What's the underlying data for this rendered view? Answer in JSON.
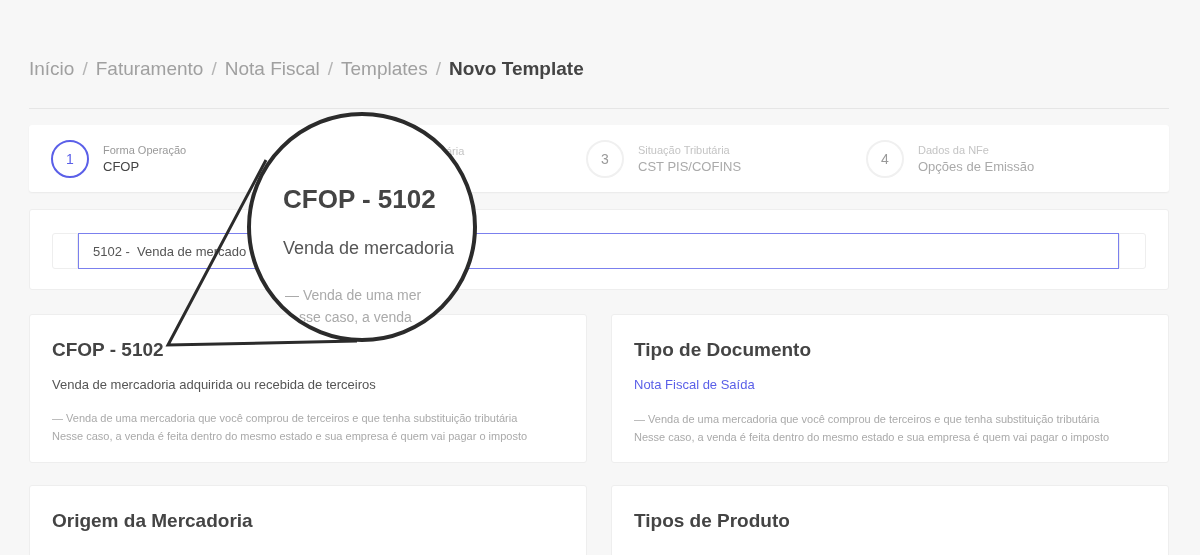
{
  "breadcrumb": {
    "separator": "/",
    "items": [
      {
        "label": "Início",
        "current": false
      },
      {
        "label": "Faturamento",
        "current": false
      },
      {
        "label": "Nota Fiscal",
        "current": false
      },
      {
        "label": "Templates",
        "current": false
      },
      {
        "label": "Novo Template",
        "current": true
      }
    ]
  },
  "steps": [
    {
      "number": "1",
      "label": "Forma Operação",
      "value": "CFOP",
      "active": true
    },
    {
      "label": "ária",
      "active": false
    },
    {
      "number": "3",
      "label": "Situação Tributária",
      "value": "CST PIS/COFINS",
      "active": false
    },
    {
      "number": "4",
      "label": "Dados da NFe",
      "value": "Opções de Emissão",
      "active": false
    }
  ],
  "search": {
    "value": "5102 -  Venda de mercado"
  },
  "cards": [
    {
      "title": "CFOP - 5102",
      "subtitle": "Venda de mercadoria adquirida ou recebida de terceiros",
      "kind": "text",
      "note_lines": [
        "—  Venda de uma mercadoria que você comprou de terceiros e que tenha substituição tributária",
        "Nesse caso, a venda é feita dentro do mesmo estado e sua empresa é quem vai pagar o imposto"
      ]
    },
    {
      "title": "Tipo de Documento",
      "subtitle": "Nota Fiscal de Saída",
      "kind": "link",
      "note_lines": [
        "—  Venda de uma mercadoria que você comprou de terceiros e que tenha substituição tributária",
        "Nesse caso, a venda é feita dentro do mesmo estado e sua empresa é quem vai pagar o imposto"
      ]
    }
  ],
  "bottom_cards": [
    {
      "title": "Origem da Mercadoria"
    },
    {
      "title": "Tipos de Produto"
    }
  ],
  "magnifier": {
    "title": "CFOP - 5102",
    "subtitle": "Venda de mercadoria",
    "note_lines": [
      "—  Venda de uma mer",
      "sse caso, a venda"
    ]
  }
}
